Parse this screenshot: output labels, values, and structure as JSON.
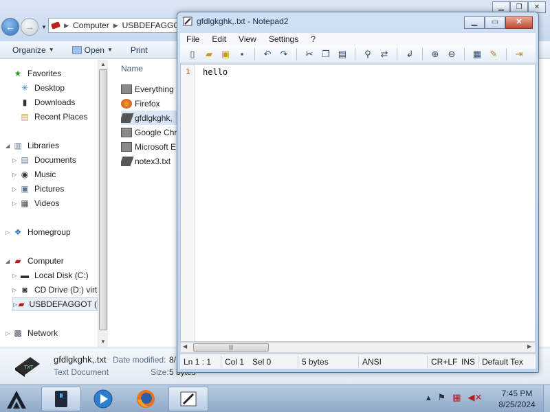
{
  "explorer": {
    "address": {
      "crumbs": [
        "Computer",
        "USBDEFAGGOT"
      ]
    },
    "toolbar": {
      "organize": "Organize",
      "open": "Open",
      "print": "Print"
    },
    "nav": {
      "favorites": "Favorites",
      "desktop": "Desktop",
      "downloads": "Downloads",
      "recent_places": "Recent Places",
      "libraries": "Libraries",
      "documents": "Documents",
      "music": "Music",
      "pictures": "Pictures",
      "videos": "Videos",
      "homegroup": "Homegroup",
      "computer": "Computer",
      "local_disk": "Local Disk (C:)",
      "cd_drive": "CD Drive (D:) virt",
      "usb": "USBDEFAGGOT (",
      "network": "Network"
    },
    "file_list": {
      "column_name": "Name",
      "files": [
        "Everything",
        "Firefox",
        "gfdlgkghk,",
        "Google Chr",
        "Microsoft E",
        "notex3.txt"
      ]
    },
    "details": {
      "name": "gfdlgkghk,.txt",
      "type": "Text Document",
      "modified_label": "Date modified:",
      "modified_value": "8/",
      "size_label": "Size:",
      "size_value": "5 bytes"
    }
  },
  "notepad": {
    "title": "gfdlgkghk,.txt - Notepad2",
    "menu": [
      "File",
      "Edit",
      "View",
      "Settings",
      "?"
    ],
    "line_number": "1",
    "content": "hello",
    "status": {
      "position": "Ln 1 : 1",
      "col": "Col 1",
      "sel": "Sel 0",
      "size": "5 bytes",
      "encoding": "ANSI",
      "eol": "CR+LF",
      "mode": "INS",
      "scheme": "Default Tex"
    }
  },
  "taskbar": {
    "time": "7:45 PM",
    "date": "8/25/2024"
  },
  "colors": {
    "selection": "#d9e6f5",
    "line_number": "#d04010",
    "close_button": "#c14a33"
  }
}
